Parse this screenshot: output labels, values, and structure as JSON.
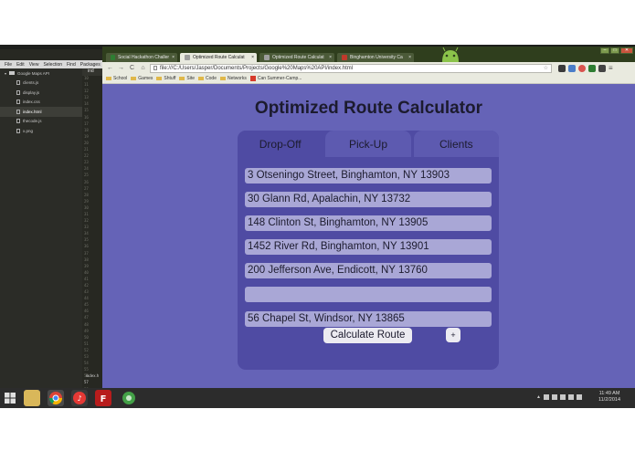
{
  "editor": {
    "menu": [
      "File",
      "Edit",
      "View",
      "Selection",
      "Find",
      "Packages"
    ],
    "folder": "Google Maps API",
    "files": [
      "clients.js",
      "display.js",
      "index.css",
      "index.html",
      "thecode.js",
      "x.png"
    ],
    "active_file": "index.html",
    "tab_label": "ind",
    "bottom_tab_label": "index.h",
    "line_numbers": [
      "10",
      "11",
      "12",
      "13",
      "14",
      "15",
      "16",
      "17",
      "18",
      "19",
      "20",
      "21",
      "22",
      "23",
      "24",
      "25",
      "26",
      "27",
      "28",
      "29",
      "30",
      "31",
      "32",
      "33",
      "34",
      "35",
      "36",
      "37",
      "38",
      "39",
      "40",
      "41",
      "42",
      "43",
      "44",
      "45",
      "46",
      "47",
      "48",
      "49",
      "50",
      "51",
      "52",
      "53",
      "54",
      "55",
      "56",
      "57",
      "58",
      "59",
      "60"
    ],
    "highlight_line": "57"
  },
  "browser": {
    "tabs": [
      {
        "label": "Social Hackathon Challer",
        "favicon_color": "#2e7d32",
        "active": false
      },
      {
        "label": "Optimized Route Calculat",
        "favicon_color": "#9e9e9e",
        "active": true
      },
      {
        "label": "Optimized Route Calculat",
        "favicon_color": "#9e9e9e",
        "active": false
      },
      {
        "label": "Binghamton University Ca",
        "favicon_color": "#c0392b",
        "active": false
      }
    ],
    "url": "file:///C:/Users/Jasper/Documents/Projects/Google%20Maps%20API/index.html",
    "bookmarks": [
      {
        "label": "School",
        "icon": "folder-icon"
      },
      {
        "label": "Games",
        "icon": "folder-icon"
      },
      {
        "label": "Shtuff",
        "icon": "folder-icon"
      },
      {
        "label": "Site",
        "icon": "folder-icon"
      },
      {
        "label": "Code",
        "icon": "folder-icon"
      },
      {
        "label": "Networks",
        "icon": "folder-icon"
      },
      {
        "label": "Can Summer-Camp...",
        "icon": "red-bookmark-icon"
      }
    ],
    "window_controls": [
      "–",
      "□",
      "✕"
    ]
  },
  "app": {
    "title": "Optimized Route Calculator",
    "tabs": [
      "Drop-Off",
      "Pick-Up",
      "Clients"
    ],
    "active_tab": "Drop-Off",
    "addresses": [
      "3 Otseningo Street, Binghamton, NY 13903",
      "30 Glann Rd, Apalachin, NY 13732",
      "148 Clinton St, Binghamton, NY 13905",
      "1452 River Rd, Binghamton, NY 13901",
      "200 Jefferson Ave, Endicott, NY 13760",
      "",
      "56 Chapel St, Windsor, NY 13865"
    ],
    "calculate_label": "Calculate Route",
    "add_label": "+"
  },
  "taskbar": {
    "time": "11:49 AM",
    "date": "11/2/2014",
    "apps": [
      "explorer-icon",
      "chrome-icon",
      "itunes-icon",
      "filezilla-icon",
      "green-app-icon"
    ]
  },
  "colors": {
    "page_bg": "#6563b7",
    "panel_bg": "#4f4ba3",
    "input_bg": "#a9a7d6",
    "button_bg": "#ecebf1",
    "text": "#1c1b2e"
  }
}
